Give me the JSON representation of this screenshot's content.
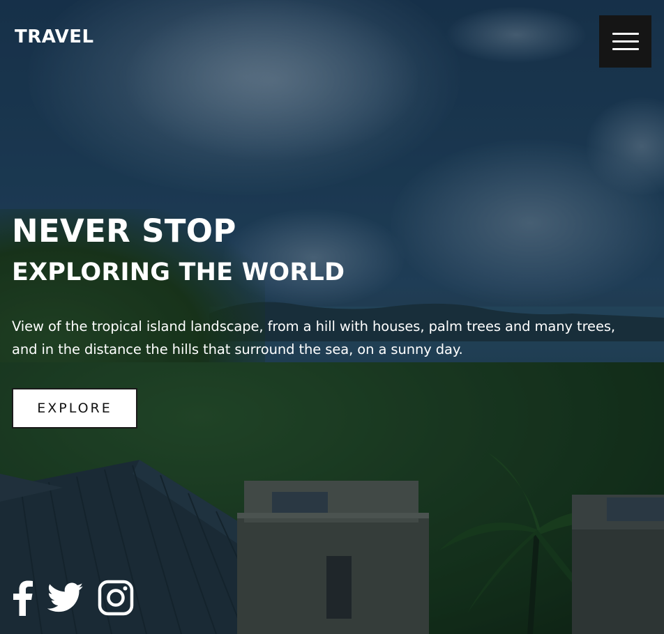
{
  "header": {
    "logo_text": "TRAVEL",
    "menu_icon": "hamburger-menu-icon"
  },
  "hero": {
    "title": "NEVER STOP",
    "subtitle": "EXPLORING THE WORLD",
    "description": "View of the tropical island landscape, from a hill with houses, palm trees and many trees, and in the distance the hills that surround the sea, on a sunny day.",
    "cta_label": "EXPLORE"
  },
  "socials": [
    {
      "name": "facebook",
      "icon": "facebook-icon"
    },
    {
      "name": "twitter",
      "icon": "twitter-icon"
    },
    {
      "name": "instagram",
      "icon": "instagram-icon"
    }
  ],
  "colors": {
    "text": "#ffffff",
    "menu_background": "#151515",
    "button_background": "#ffffff",
    "button_text": "#111111"
  }
}
